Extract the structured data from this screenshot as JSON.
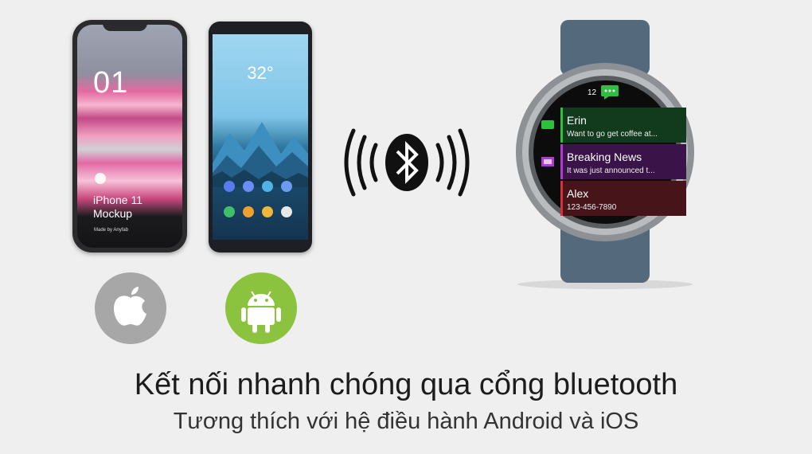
{
  "iphone": {
    "screen_number": "01",
    "model_label_line1": "iPhone 11",
    "model_label_line2": "Mockup",
    "made_by": "Made by Anyfab"
  },
  "android_phone": {
    "temperature": "32°"
  },
  "watch": {
    "time_hour": "12",
    "notifications": [
      {
        "title": "Erin",
        "subtitle": "Want to go get coffee at...",
        "accent": "#2fbf3f"
      },
      {
        "title": "Breaking News",
        "subtitle": "It was just announced t...",
        "accent": "#b03bd1"
      },
      {
        "title": "Alex",
        "subtitle": "123-456-7890",
        "accent": "#d6303b"
      }
    ]
  },
  "caption": {
    "title": "Kết nối nhanh chóng qua cổng bluetooth",
    "subtitle": "Tương thích với hệ điều hành Android và iOS"
  },
  "icons": [
    "bluetooth-icon",
    "apple-logo-icon",
    "android-logo-icon",
    "chat-icon",
    "news-icon"
  ],
  "colors": {
    "background": "#efefef",
    "android_green": "#8bc23e",
    "apple_gray": "#a7a7a7"
  }
}
